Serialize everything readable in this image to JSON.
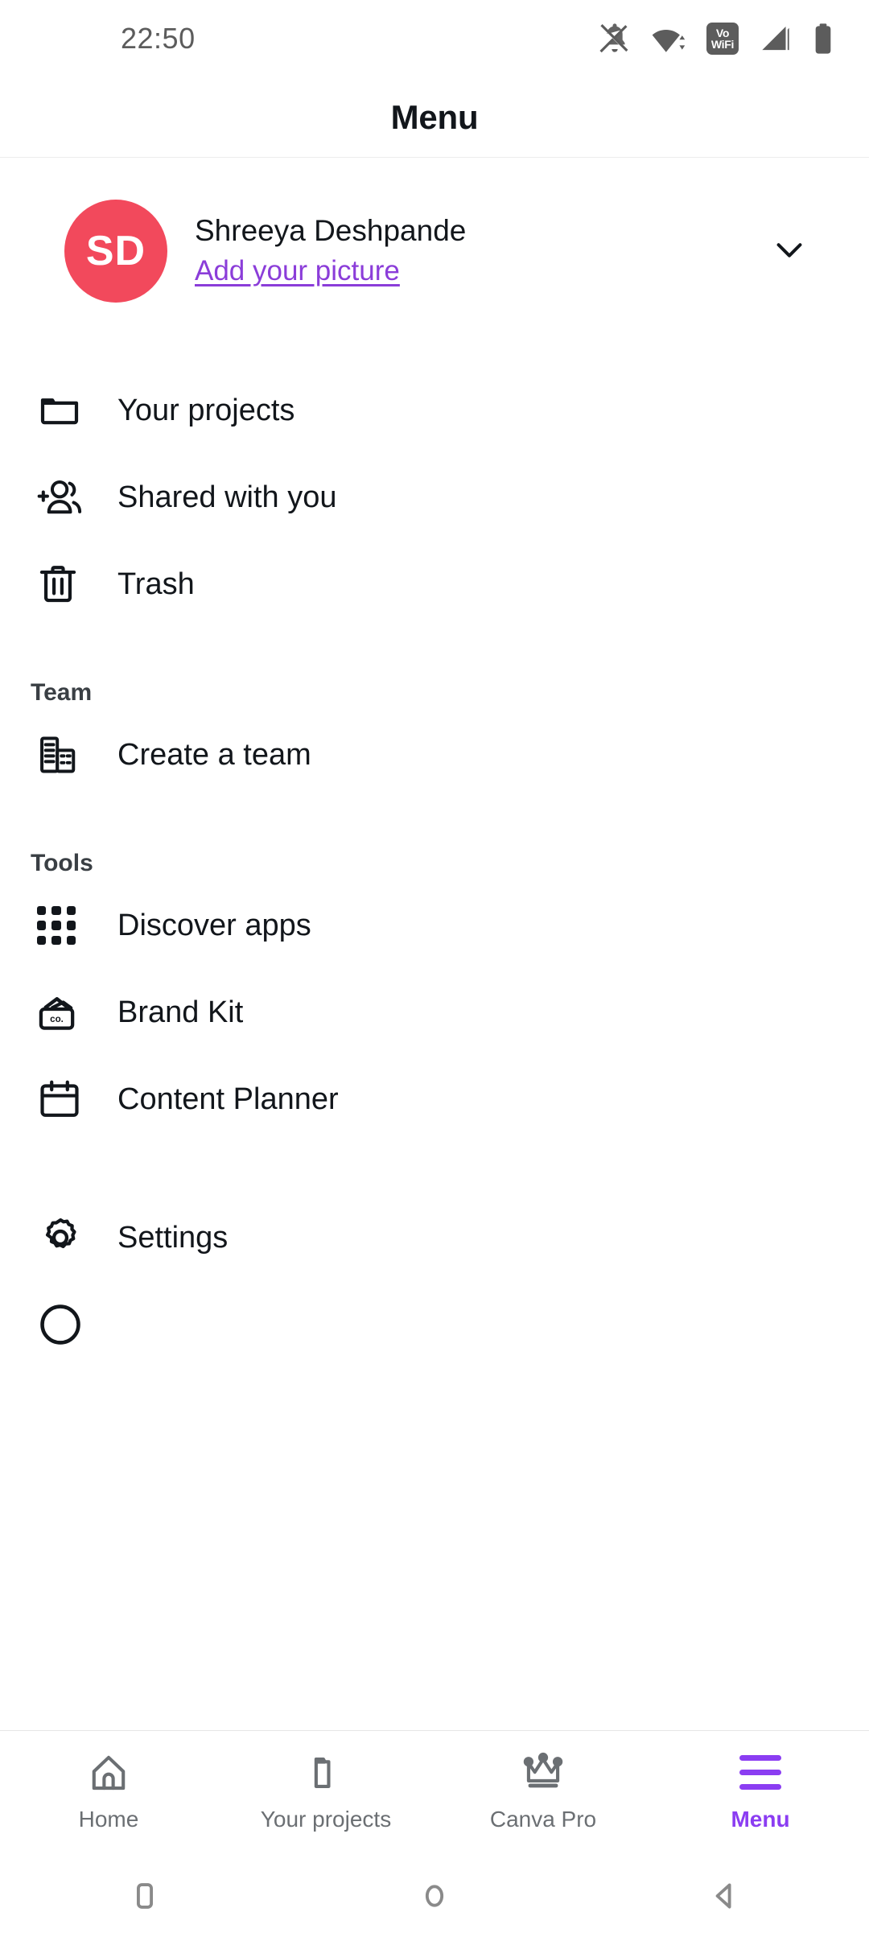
{
  "status_bar": {
    "time": "22:50",
    "icons": [
      {
        "name": "notifications-off-icon",
        "label": "silent"
      },
      {
        "name": "wifi-icon",
        "label": "wifi"
      },
      {
        "name": "vowifi-icon",
        "line1": "Vo",
        "line2": "WiFi"
      },
      {
        "name": "signal-icon",
        "label": "signal"
      },
      {
        "name": "battery-icon",
        "label": "battery"
      }
    ]
  },
  "header": {
    "title": "Menu"
  },
  "profile": {
    "initials": "SD",
    "name": "Shreeya Deshpande",
    "link_label": "Add your picture",
    "avatar_color": "#f2495c",
    "link_color": "#8b3dd9",
    "expand_icon": "chevron-down-icon"
  },
  "menu": {
    "primary_items": [
      {
        "label": "Your projects",
        "icon": "folder-icon"
      },
      {
        "label": "Shared with you",
        "icon": "add-person-icon"
      },
      {
        "label": "Trash",
        "icon": "trash-icon"
      }
    ],
    "sections": [
      {
        "header": "Team",
        "items": [
          {
            "label": "Create a team",
            "icon": "building-icon"
          }
        ]
      },
      {
        "header": "Tools",
        "items": [
          {
            "label": "Discover apps",
            "icon": "apps-grid-icon"
          },
          {
            "label": "Brand Kit",
            "icon": "brand-card-icon"
          },
          {
            "label": "Content Planner",
            "icon": "calendar-icon"
          }
        ]
      }
    ],
    "footer_items": [
      {
        "label": "Settings",
        "icon": "gear-icon"
      }
    ]
  },
  "bottom_nav": {
    "active_color": "#8b3df2",
    "inactive_color": "#6b6f73",
    "items": [
      {
        "label": "Home",
        "icon": "home-icon",
        "active": false
      },
      {
        "label": "Your projects",
        "icon": "folder-icon",
        "active": false
      },
      {
        "label": "Canva Pro",
        "icon": "crown-icon",
        "active": false
      },
      {
        "label": "Menu",
        "icon": "hamburger-icon",
        "active": true
      }
    ]
  },
  "android_nav": {
    "buttons": [
      {
        "name": "recents-button",
        "icon": "square-icon"
      },
      {
        "name": "home-button",
        "icon": "circle-icon"
      },
      {
        "name": "back-button",
        "icon": "triangle-left-icon"
      }
    ]
  }
}
